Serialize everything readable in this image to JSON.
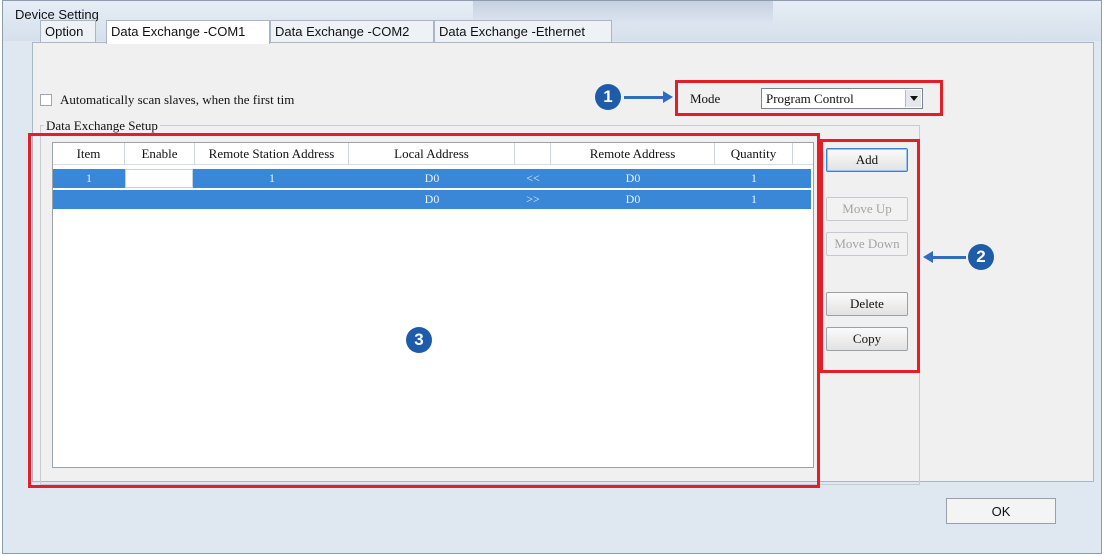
{
  "window": {
    "title": "Device Setting"
  },
  "tabs": [
    {
      "label": "Option"
    },
    {
      "label": "Data Exchange -COM1"
    },
    {
      "label": "Data Exchange -COM2"
    },
    {
      "label": "Data Exchange -Ethernet"
    }
  ],
  "scan_checkbox": {
    "label": "Automatically scan slaves, when the first tim"
  },
  "mode": {
    "label": "Mode",
    "value": "Program Control"
  },
  "group": {
    "label": "Data Exchange Setup"
  },
  "table": {
    "headers": [
      "Item",
      "Enable",
      "Remote Station Address",
      "Local Address",
      "",
      "Remote Address",
      "Quantity"
    ],
    "rows": [
      {
        "item": "1",
        "enable": "",
        "remote_station": "1",
        "local": "D0",
        "direction": "<<",
        "remote": "D0",
        "quantity": "1"
      },
      {
        "item": "",
        "enable": "",
        "remote_station": "",
        "local": "D0",
        "direction": ">>",
        "remote": "D0",
        "quantity": "1"
      }
    ]
  },
  "buttons": {
    "add": "Add",
    "move_up": "Move Up",
    "move_down": "Move Down",
    "delete": "Delete",
    "copy": "Copy",
    "ok": "OK"
  },
  "callouts": {
    "one": "1",
    "two": "2",
    "three": "3"
  },
  "colors": {
    "highlight": "#e41e26",
    "badge": "#1e5ba8",
    "selection": "#3a87d8"
  }
}
